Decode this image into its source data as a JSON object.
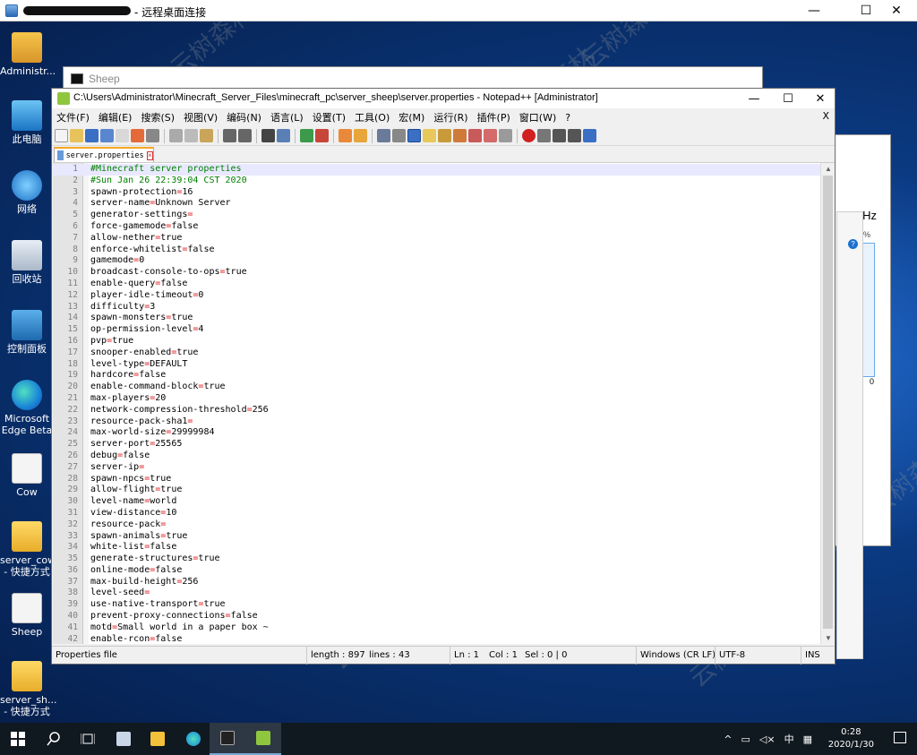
{
  "rdp": {
    "title": "- 远程桌面连接",
    "minimize": "—",
    "maximize": "☐",
    "close": "✕"
  },
  "desktop": {
    "icons": [
      {
        "label": "Administr...",
        "glyph": "user-folder-icon"
      },
      {
        "label": "此电脑",
        "glyph": "computer-icon"
      },
      {
        "label": "网络",
        "glyph": "network-icon"
      },
      {
        "label": "回收站",
        "glyph": "recycle-bin-icon"
      },
      {
        "label": "控制面板",
        "glyph": "control-panel-icon"
      },
      {
        "label": "Microsoft Edge Beta",
        "glyph": "edge-beta-icon"
      },
      {
        "label": "Cow",
        "glyph": "config-file-icon"
      },
      {
        "label": "server_cow - 快捷方式",
        "glyph": "folder-shortcut-icon"
      },
      {
        "label": "Sheep",
        "glyph": "config-file-icon"
      },
      {
        "label": "server_sh... - 快捷方式",
        "glyph": "folder-shortcut-icon"
      }
    ],
    "watermark": "云树森林"
  },
  "background_windows": {
    "sheep_console_title": "Sheep",
    "perf_ghz": "GHz",
    "perf_pct": "0%",
    "perf_zero": "0"
  },
  "npp": {
    "title": "C:\\Users\\Administrator\\Minecraft_Server_Files\\minecraft_pc\\server_sheep\\server.properties - Notepad++ [Administrator]",
    "menu": [
      "文件(F)",
      "编辑(E)",
      "搜索(S)",
      "视图(V)",
      "编码(N)",
      "语言(L)",
      "设置(T)",
      "工具(O)",
      "宏(M)",
      "运行(R)",
      "插件(P)",
      "窗口(W)",
      "?"
    ],
    "menu_close": "X",
    "tab": "server.properties",
    "lines": [
      {
        "n": "1",
        "c": "#Minecraft server properties"
      },
      {
        "n": "2",
        "c": "#Sun Jan 26 22:39:04 CST 2020"
      },
      {
        "n": "3",
        "k": "spawn-protection",
        "v": "16"
      },
      {
        "n": "4",
        "k": "server-name",
        "v": "Unknown Server"
      },
      {
        "n": "5",
        "k": "generator-settings",
        "v": ""
      },
      {
        "n": "6",
        "k": "force-gamemode",
        "v": "false"
      },
      {
        "n": "7",
        "k": "allow-nether",
        "v": "true"
      },
      {
        "n": "8",
        "k": "enforce-whitelist",
        "v": "false"
      },
      {
        "n": "9",
        "k": "gamemode",
        "v": "0"
      },
      {
        "n": "10",
        "k": "broadcast-console-to-ops",
        "v": "true"
      },
      {
        "n": "11",
        "k": "enable-query",
        "v": "false"
      },
      {
        "n": "12",
        "k": "player-idle-timeout",
        "v": "0"
      },
      {
        "n": "13",
        "k": "difficulty",
        "v": "3"
      },
      {
        "n": "14",
        "k": "spawn-monsters",
        "v": "true"
      },
      {
        "n": "15",
        "k": "op-permission-level",
        "v": "4"
      },
      {
        "n": "16",
        "k": "pvp",
        "v": "true"
      },
      {
        "n": "17",
        "k": "snooper-enabled",
        "v": "true"
      },
      {
        "n": "18",
        "k": "level-type",
        "v": "DEFAULT"
      },
      {
        "n": "19",
        "k": "hardcore",
        "v": "false"
      },
      {
        "n": "20",
        "k": "enable-command-block",
        "v": "true"
      },
      {
        "n": "21",
        "k": "max-players",
        "v": "20"
      },
      {
        "n": "22",
        "k": "network-compression-threshold",
        "v": "256"
      },
      {
        "n": "23",
        "k": "resource-pack-sha1",
        "v": ""
      },
      {
        "n": "24",
        "k": "max-world-size",
        "v": "29999984"
      },
      {
        "n": "25",
        "k": "server-port",
        "v": "25565"
      },
      {
        "n": "26",
        "k": "debug",
        "v": "false"
      },
      {
        "n": "27",
        "k": "server-ip",
        "v": ""
      },
      {
        "n": "28",
        "k": "spawn-npcs",
        "v": "true"
      },
      {
        "n": "29",
        "k": "allow-flight",
        "v": "true"
      },
      {
        "n": "30",
        "k": "level-name",
        "v": "world"
      },
      {
        "n": "31",
        "k": "view-distance",
        "v": "10"
      },
      {
        "n": "32",
        "k": "resource-pack",
        "v": ""
      },
      {
        "n": "33",
        "k": "spawn-animals",
        "v": "true"
      },
      {
        "n": "34",
        "k": "white-list",
        "v": "false"
      },
      {
        "n": "35",
        "k": "generate-structures",
        "v": "true"
      },
      {
        "n": "36",
        "k": "online-mode",
        "v": "false"
      },
      {
        "n": "37",
        "k": "max-build-height",
        "v": "256"
      },
      {
        "n": "38",
        "k": "level-seed",
        "v": ""
      },
      {
        "n": "39",
        "k": "use-native-transport",
        "v": "true"
      },
      {
        "n": "40",
        "k": "prevent-proxy-connections",
        "v": "false"
      },
      {
        "n": "41",
        "k": "motd",
        "v": "Small world in a paper box ~"
      },
      {
        "n": "42",
        "k": "enable-rcon",
        "v": "false"
      }
    ],
    "status": {
      "type": "Properties file",
      "length": "length : 897",
      "lines": "lines : 43",
      "ln": "Ln : 1",
      "col": "Col : 1",
      "sel": "Sel : 0 | 0",
      "eol": "Windows (CR LF)",
      "encoding": "UTF-8",
      "mode": "INS"
    }
  },
  "taskbar": {
    "tray_chevron": "^",
    "ime": "中",
    "time": "0:28",
    "date": "2020/1/30"
  },
  "colors": {
    "comment": "#008000",
    "equals": "#e01b1b",
    "current_line": "#e8e8ff",
    "taskbar": "#101820"
  }
}
